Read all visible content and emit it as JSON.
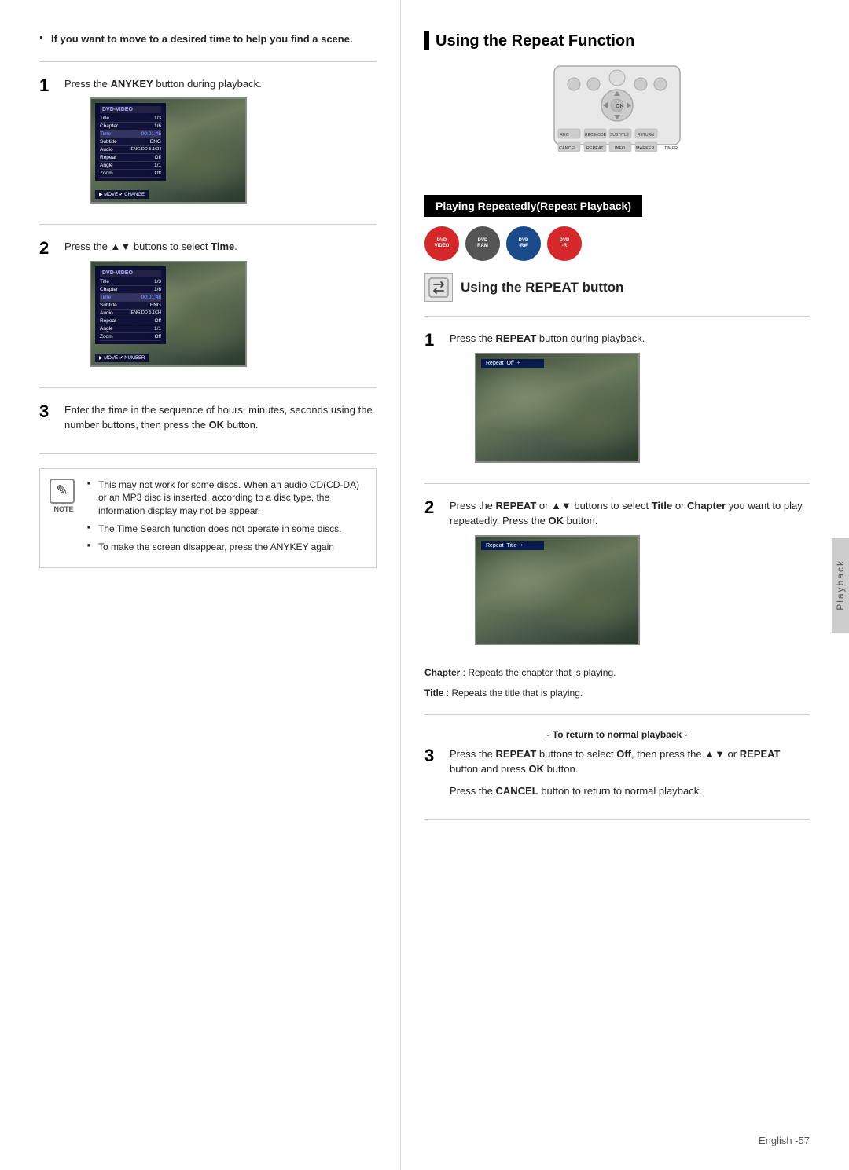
{
  "left": {
    "bullet_header": "If you want to move to a desired time to help you find a scene.",
    "step1": {
      "num": "1",
      "text_before": "Press the ",
      "bold_word": "ANYKEY",
      "text_after": " button during playback."
    },
    "step2": {
      "num": "2",
      "text_before": "Press the ▲▼ buttons to select ",
      "bold_word": "Time",
      "text_after": "."
    },
    "step3": {
      "num": "3",
      "text": "Enter the time in the sequence of hours, minutes, seconds using the number buttons, then press the ",
      "bold_word": "OK",
      "text_after": " button."
    },
    "note": {
      "label": "NOTE",
      "items": [
        "This may not work for some discs. When an audio CD(CD-DA) or an MP3 disc is inserted, according to a disc type, the information display may not be appear.",
        "The Time Search function does not operate in some discs.",
        "To make the screen disappear, press the ANYKEY again"
      ]
    },
    "dvd_menu1": {
      "title": "DVD-VIDEO",
      "rows": [
        {
          "label": "Title",
          "value": "1/3",
          "highlight": false
        },
        {
          "label": "Chapter",
          "value": "1/6",
          "highlight": false
        },
        {
          "label": "Time",
          "value": "00:01:45",
          "highlight": true
        },
        {
          "label": "Subtitle",
          "value": "ENG",
          "highlight": false
        },
        {
          "label": "Audio",
          "value": "ENG DD 5.1CH",
          "highlight": false
        },
        {
          "label": "Repeat",
          "value": "Off",
          "highlight": false
        },
        {
          "label": "Angle",
          "value": "1/1",
          "highlight": false
        },
        {
          "label": "Zoom",
          "value": "Off",
          "highlight": false
        }
      ],
      "footer": "▶ MOVE ✔ CHANGE"
    },
    "dvd_menu2": {
      "title": "DVD-VIDEO",
      "rows": [
        {
          "label": "Title",
          "value": "1/3",
          "highlight": false
        },
        {
          "label": "Chapter",
          "value": "1/6",
          "highlight": false
        },
        {
          "label": "Time",
          "value": "00:01:48",
          "highlight": true
        },
        {
          "label": "Subtitle",
          "value": "ENG",
          "highlight": false
        },
        {
          "label": "Audio",
          "value": "ENG DD 5.1CH",
          "highlight": false
        },
        {
          "label": "Repeat",
          "value": "Off",
          "highlight": false
        },
        {
          "label": "Angle",
          "value": "1/1",
          "highlight": false
        },
        {
          "label": "Zoom",
          "value": "Off",
          "highlight": false
        }
      ],
      "footer": "▶ MOVE ✔ NUMBER"
    }
  },
  "right": {
    "section_title": "Using the Repeat Function",
    "playing_banner": "Playing Repeatedly(Repeat Playback)",
    "disc_icons": [
      {
        "label": "DVD\nVIDEO",
        "type": "dvd-video"
      },
      {
        "label": "DVD\nRAM",
        "type": "dvd-ram"
      },
      {
        "label": "DVD\nRW",
        "type": "dvd-rw"
      },
      {
        "label": "DVD\nR",
        "type": "dvd-r"
      }
    ],
    "sub_section_title": "Using the REPEAT button",
    "step1": {
      "num": "1",
      "text_before": "Press the ",
      "bold_word": "REPEAT",
      "text_after": " button during playback."
    },
    "step2": {
      "num": "2",
      "text_p1_before": "Press the ",
      "text_p1_bold1": "REPEAT",
      "text_p1_mid": " or ▲▼ buttons to select ",
      "text_p1_bold2": "Title",
      "text_p1_mid2": " or ",
      "text_p1_bold3": "Chapter",
      "text_p1_after": " you want to play repeatedly.",
      "text_p2_before": "Press the ",
      "text_p2_bold": "OK",
      "text_p2_after": " button."
    },
    "repeat_off": "Repeat  Off  ÷",
    "repeat_title": "Repeat  Title  ÷",
    "captions": {
      "chapter": "Chapter",
      "chapter_text": " : Repeats the chapter that is playing.",
      "title": "Title",
      "title_text": " : Repeats the title that is playing."
    },
    "normal_playback_label": "- To return to normal playback -",
    "step3": {
      "num": "3",
      "text_p1_before": "Press the ",
      "text_p1_bold1": "REPEAT",
      "text_p1_mid": " buttons to select ",
      "text_p1_bold2": "Off",
      "text_p1_after": ",",
      "text_p2": "then press the ▲▼ or ",
      "text_p2_bold1": "REPEAT",
      "text_p2_mid": " button and press ",
      "text_p2_bold2": "OK",
      "text_p2_after": " button.",
      "text_p3_before": "Press the ",
      "text_p3_bold": "CANCEL",
      "text_p3_after": " button to return to normal playback."
    }
  },
  "side_tab": "Playback",
  "page_footer": "English -57"
}
